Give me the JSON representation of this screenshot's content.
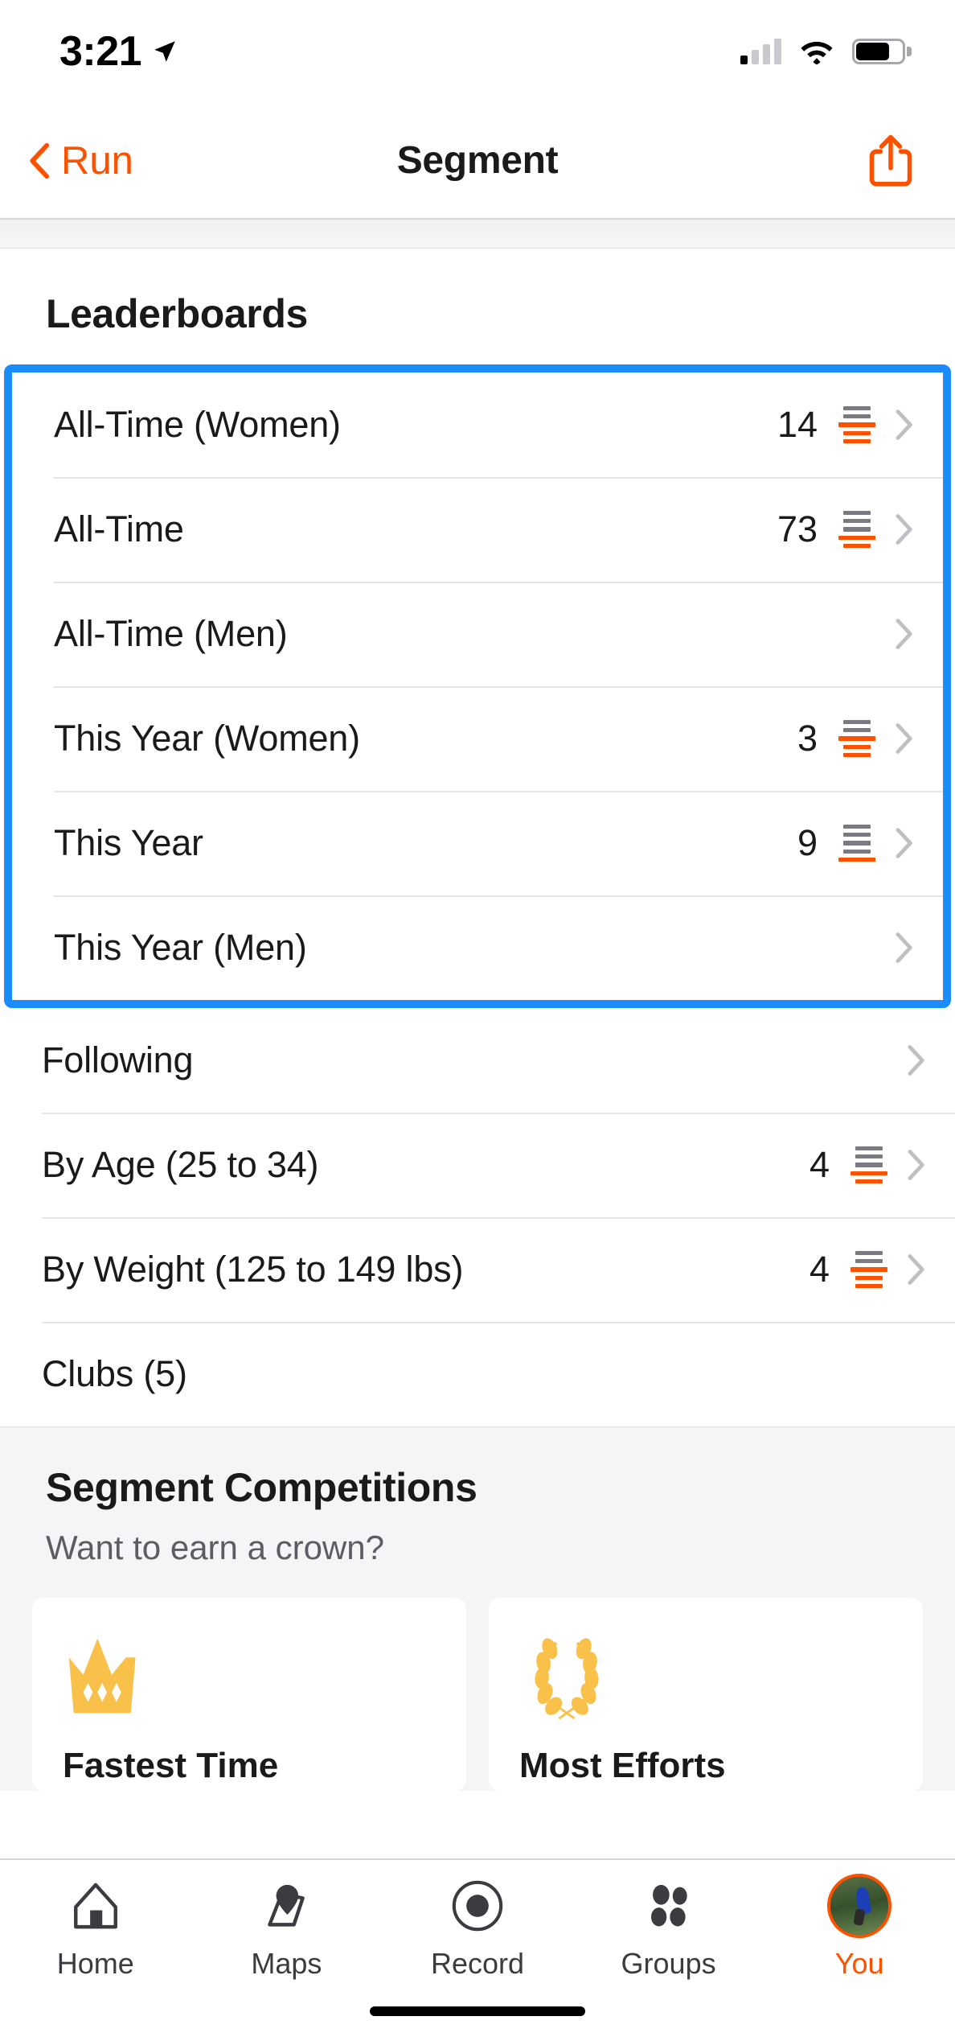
{
  "status_bar": {
    "time": "3:21",
    "location_icon": "location-arrow-icon",
    "cellular_icon": "cellular-signal-icon",
    "wifi_icon": "wifi-icon",
    "battery_icon": "battery-icon",
    "battery_level_pct": 62,
    "signal_bars_filled": 1,
    "signal_bars_total": 4
  },
  "nav_bar": {
    "back_label": "Run",
    "back_icon": "chevron-left-icon",
    "title": "Segment",
    "share_icon": "share-icon",
    "accent_color": "#fc5200"
  },
  "leaderboards": {
    "section_title": "Leaderboards",
    "highlight_color": "#1a8cff",
    "highlighted_rows": [
      {
        "label": "All-Time (Women)",
        "count": "14",
        "has_rank_icon": true,
        "rank_icon": "rank-bars-icon",
        "gray_bars": 2,
        "orange_bars": 3
      },
      {
        "label": "All-Time",
        "count": "73",
        "has_rank_icon": true,
        "rank_icon": "rank-bars-icon",
        "gray_bars": 3,
        "orange_bars": 2
      },
      {
        "label": "All-Time (Men)",
        "count": "",
        "has_rank_icon": false,
        "rank_icon": "",
        "gray_bars": 0,
        "orange_bars": 0
      },
      {
        "label": "This Year (Women)",
        "count": "3",
        "has_rank_icon": true,
        "rank_icon": "rank-bars-icon",
        "gray_bars": 2,
        "orange_bars": 3
      },
      {
        "label": "This Year",
        "count": "9",
        "has_rank_icon": true,
        "rank_icon": "rank-bars-icon",
        "gray_bars": 4,
        "orange_bars": 1
      },
      {
        "label": "This Year (Men)",
        "count": "",
        "has_rank_icon": false,
        "rank_icon": "",
        "gray_bars": 0,
        "orange_bars": 0
      }
    ],
    "other_rows": [
      {
        "label": "Following",
        "count": "",
        "has_rank_icon": false,
        "rank_icon": "",
        "gray_bars": 0,
        "orange_bars": 0
      },
      {
        "label": "By Age (25 to 34)",
        "count": "4",
        "has_rank_icon": true,
        "rank_icon": "rank-bars-icon",
        "gray_bars": 3,
        "orange_bars": 2
      },
      {
        "label": "By Weight (125 to 149 lbs)",
        "count": "4",
        "has_rank_icon": true,
        "rank_icon": "rank-bars-icon",
        "gray_bars": 2,
        "orange_bars": 3
      },
      {
        "label": "Clubs (5)",
        "count": "",
        "has_rank_icon": false,
        "rank_icon": "",
        "gray_bars": 0,
        "orange_bars": 0,
        "no_chevron": true
      }
    ],
    "chevron_icon": "chevron-right-icon"
  },
  "segment_competitions": {
    "title": "Segment Competitions",
    "subtitle": "Want to earn a crown?",
    "gold_color": "#f9c košer"
  },
  "competition_cards": [
    {
      "label": "Fastest Time",
      "icon": "crown-icon",
      "color": "#fac14a"
    },
    {
      "label": "Most Efforts",
      "icon": "laurel-wreath-icon",
      "color": "#fac14a"
    }
  ],
  "tab_bar": {
    "items": [
      {
        "label": "Home",
        "icon": "home-icon",
        "active": false
      },
      {
        "label": "Maps",
        "icon": "map-pin-icon",
        "active": false
      },
      {
        "label": "Record",
        "icon": "record-circle-icon",
        "active": false
      },
      {
        "label": "Groups",
        "icon": "groups-dots-icon",
        "active": false
      },
      {
        "label": "You",
        "icon": "avatar-icon",
        "active": true
      }
    ],
    "active_color": "#fc5200"
  }
}
